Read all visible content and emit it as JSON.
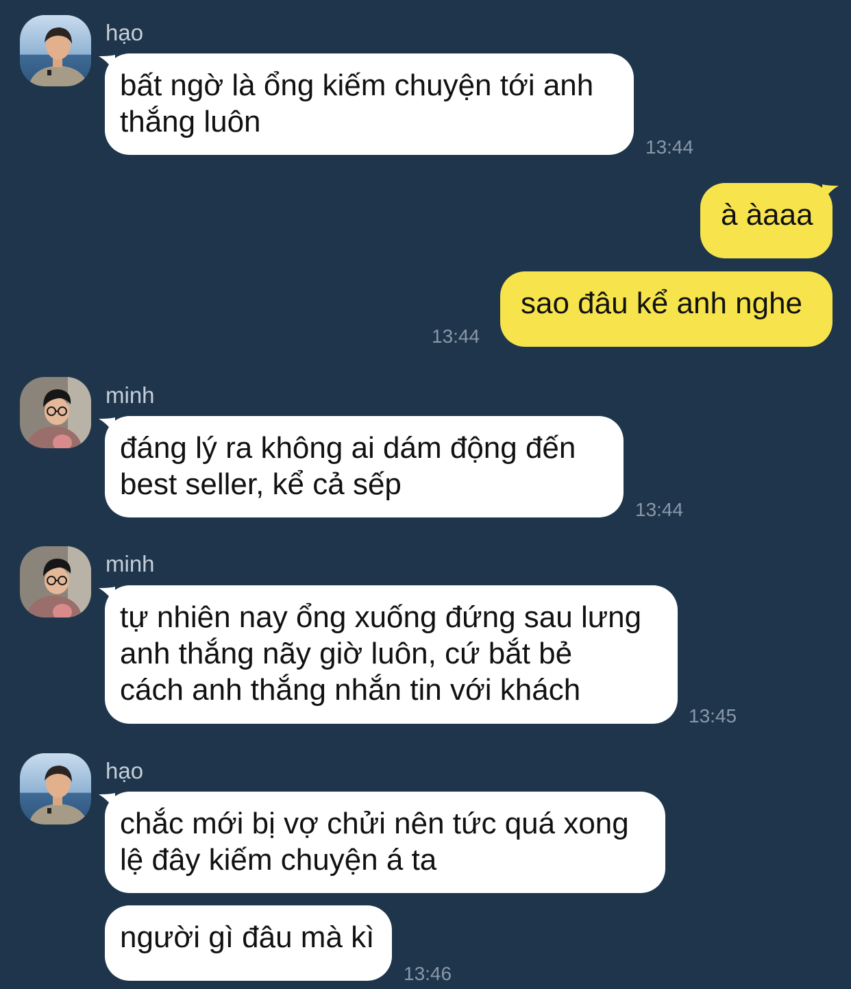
{
  "messages": [
    {
      "sender": "hạo",
      "lines": [
        "bất ngờ là ổng kiếm chuyện tới anh",
        "thắng luôn"
      ],
      "time": "13:44"
    },
    {
      "lines": [
        "à àaaa"
      ]
    },
    {
      "lines": [
        "sao đâu kể anh nghe"
      ],
      "time": "13:44"
    },
    {
      "sender": "minh",
      "lines": [
        "đáng lý ra không ai dám động đến",
        "best seller, kể cả sếp"
      ],
      "time": "13:44"
    },
    {
      "sender": "minh",
      "lines": [
        "tự nhiên nay ổng xuống đứng sau lưng",
        "anh thắng nãy giờ luôn, cứ bắt bẻ",
        "cách anh thắng nhắn tin với khách"
      ],
      "time": "13:45"
    },
    {
      "sender": "hạo",
      "lines": [
        "chắc mới bị vợ chửi nên tức quá xong",
        "lệ đây kiếm chuyện á ta"
      ]
    },
    {
      "lines": [
        "người gì đâu mà kì"
      ],
      "time": "13:46"
    }
  ],
  "colors": {
    "background": "#1e354b",
    "incoming_bubble": "#ffffff",
    "outgoing_bubble": "#f7e44d",
    "timestamp": "#8a99a8",
    "sender_name": "#c5cfd9"
  },
  "icons": [
    "avatar-hao-icon",
    "avatar-minh-icon"
  ]
}
